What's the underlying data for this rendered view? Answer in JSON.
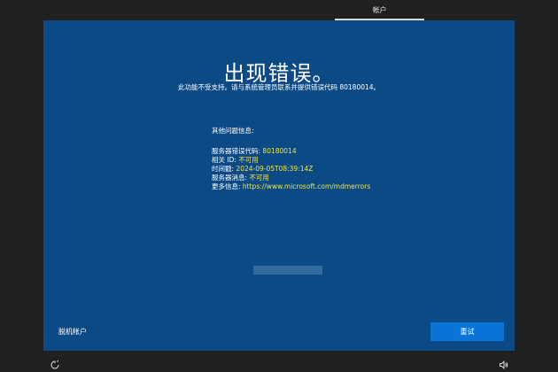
{
  "top_tab": {
    "label": "帐户"
  },
  "error": {
    "title": "出现错误。",
    "subtitle": "此功能不受支持。请与系统管理员联系并提供错误代码 80180014。"
  },
  "info": {
    "heading": "其他问题信息:",
    "rows": [
      {
        "label": "服务器错误代码: ",
        "value": "80180014"
      },
      {
        "label": "相关 ID: ",
        "value": "不可用"
      },
      {
        "label": "时间戳: ",
        "value": "2024-09-05T08:39:14Z"
      },
      {
        "label": "服务器消息: ",
        "value": "不可用"
      },
      {
        "label": "更多信息: ",
        "value": "https://www.microsoft.com/mdmerrors"
      }
    ]
  },
  "footer": {
    "offline_label": "脱机帐户",
    "retry_label": "重试"
  },
  "icons": {
    "ease_of_access": "ease-of-access-icon",
    "volume": "volume-icon"
  },
  "colors": {
    "panel": "#0c4a86",
    "accent": "#0a74d6",
    "highlight": "#f3e24a"
  }
}
